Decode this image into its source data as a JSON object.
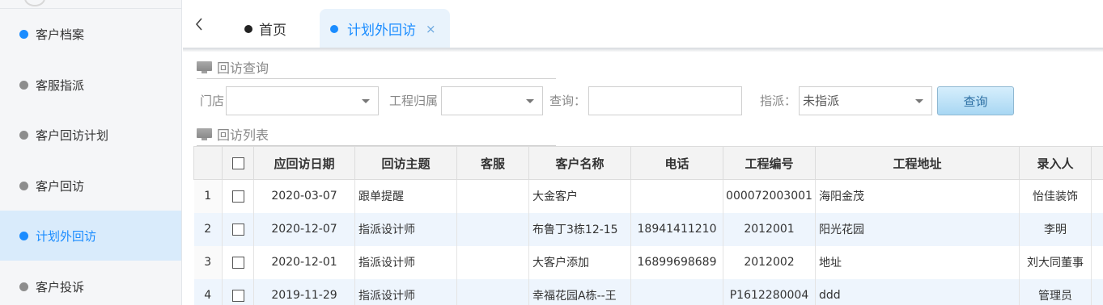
{
  "sidebar": {
    "items": [
      {
        "label": "客户档案"
      },
      {
        "label": "客服指派"
      },
      {
        "label": "客户回访计划"
      },
      {
        "label": "客户回访"
      },
      {
        "label": "计划外回访"
      },
      {
        "label": "客户投诉"
      }
    ]
  },
  "tabs": {
    "back_icon": "chevron-left-icon",
    "home": "首页",
    "active": "计划外回访",
    "close": "×"
  },
  "query_section": {
    "title": "回访查询"
  },
  "filters": {
    "store_label": "门店",
    "store_value": "",
    "project_label": "工程归属",
    "project_value": "",
    "query_label": "查询：",
    "query_value": "",
    "assign_label": "指派：",
    "assign_value": "未指派",
    "search_button": "查询"
  },
  "list_section": {
    "title": "回访列表"
  },
  "table": {
    "headers": [
      "应回访日期",
      "回访主题",
      "客服",
      "客户名称",
      "电话",
      "工程编号",
      "工程地址",
      "录入人"
    ],
    "rows": [
      {
        "num": "1",
        "date": "2020-03-07",
        "topic": "跟单提醒",
        "service": "",
        "customer": "大金客户",
        "phone": "",
        "code": "000072003001",
        "address": "海阳金茂",
        "creator": "怡佳装饰"
      },
      {
        "num": "2",
        "date": "2020-12-07",
        "topic": "指派设计师",
        "service": "",
        "customer": "布鲁丁3栋12-15",
        "phone": "18941411210",
        "code": "2012001",
        "address": "阳光花园",
        "creator": "李明"
      },
      {
        "num": "3",
        "date": "2020-12-01",
        "topic": "指派设计师",
        "service": "",
        "customer": "大客户添加",
        "phone": "16899698689",
        "code": "2012002",
        "address": "地址",
        "creator": "刘大同董事"
      },
      {
        "num": "4",
        "date": "2019-11-29",
        "topic": "指派设计师",
        "service": "",
        "customer": "幸福花园A栋--王",
        "phone": "",
        "code": "P1612280004",
        "address": "ddd",
        "creator": "管理员"
      }
    ]
  },
  "colors": {
    "accent": "#1a8cff",
    "active_bg": "#d9ebfb",
    "row_alt": "#eef5fd"
  }
}
